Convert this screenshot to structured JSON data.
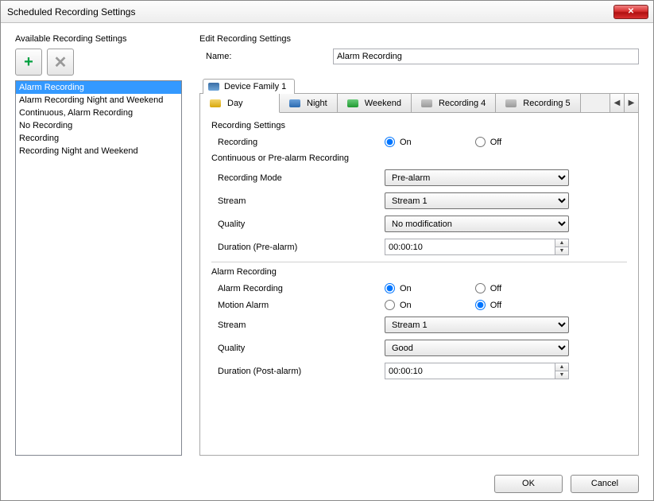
{
  "window": {
    "title": "Scheduled Recording Settings"
  },
  "left": {
    "legend": "Available Recording Settings",
    "items": [
      "Alarm Recording",
      "Alarm Recording Night and Weekend",
      "Continuous, Alarm Recording",
      "No Recording",
      "Recording",
      "Recording Night and Weekend"
    ],
    "selected_index": 0
  },
  "edit": {
    "legend": "Edit Recording Settings",
    "name_label": "Name:",
    "name_value": "Alarm Recording",
    "device_tab": "Device Family 1",
    "inner_tabs": [
      {
        "label": "Day",
        "icon": "rec-yellow",
        "active": true
      },
      {
        "label": "Night",
        "icon": "rec-blue",
        "active": false
      },
      {
        "label": "Weekend",
        "icon": "rec-green",
        "active": false
      },
      {
        "label": "Recording 4",
        "icon": "rec-gray",
        "active": false
      },
      {
        "label": "Recording 5",
        "icon": "rec-gray",
        "active": false
      }
    ],
    "recording_settings_legend": "Recording Settings",
    "recording_label": "Recording",
    "on": "On",
    "off": "Off",
    "recording_value": "On",
    "cont_legend": "Continuous or Pre-alarm Recording",
    "mode_label": "Recording Mode",
    "mode_value": "Pre-alarm",
    "stream_label": "Stream",
    "stream_value": "Stream 1",
    "quality_label": "Quality",
    "quality_value": "No modification",
    "dur_pre_label": "Duration (Pre-alarm)",
    "dur_pre_value": "00:00:10",
    "alarm_legend": "Alarm Recording",
    "alarm_rec_label": "Alarm Recording",
    "alarm_rec_value": "On",
    "motion_label": "Motion Alarm",
    "motion_value": "Off",
    "alarm_stream_label": "Stream",
    "alarm_stream_value": "Stream 1",
    "alarm_quality_label": "Quality",
    "alarm_quality_value": "Good",
    "dur_post_label": "Duration (Post-alarm)",
    "dur_post_value": "00:00:10"
  },
  "footer": {
    "ok": "OK",
    "cancel": "Cancel"
  }
}
